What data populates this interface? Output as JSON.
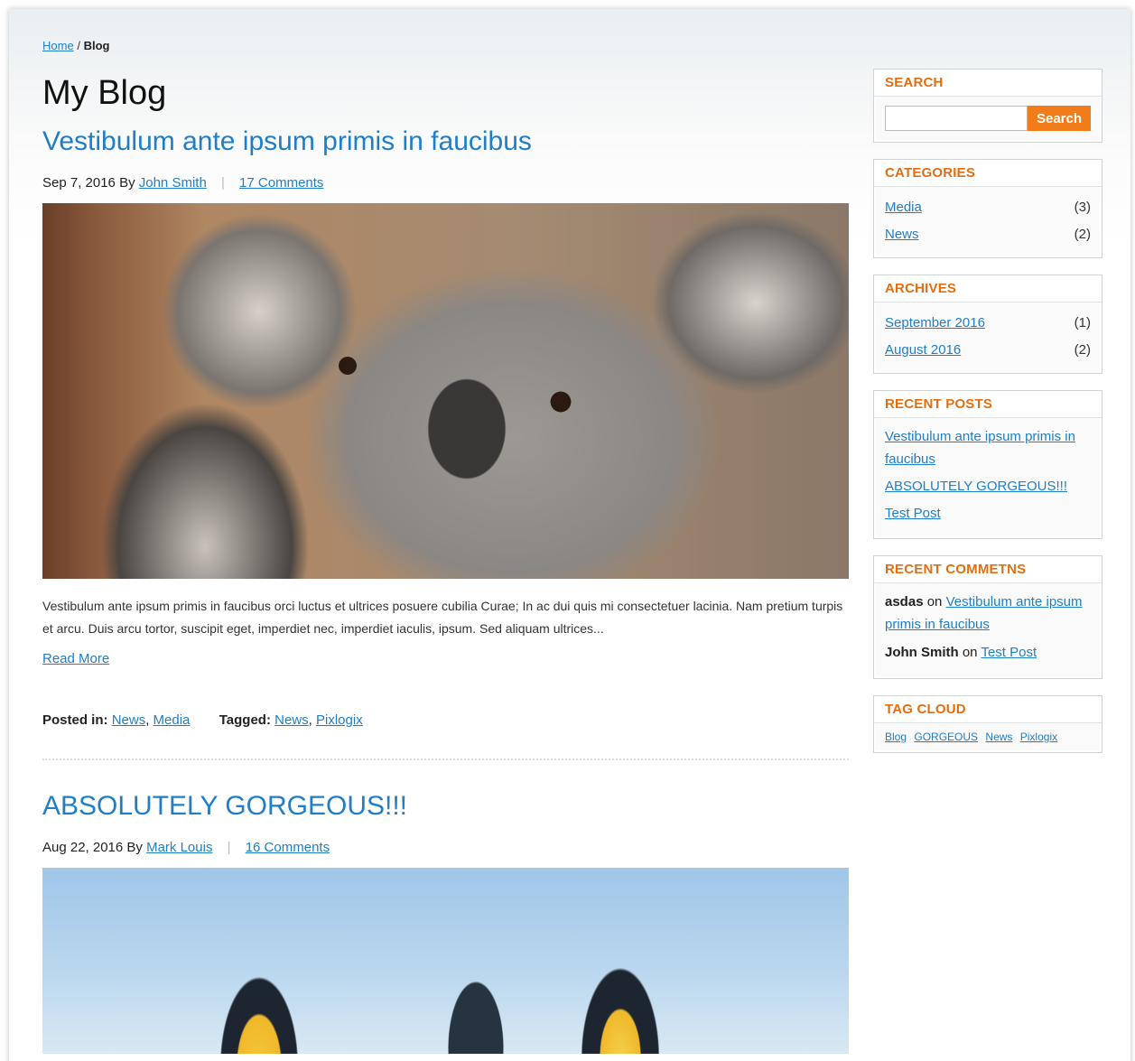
{
  "breadcrumb": {
    "home": "Home",
    "separator": "/",
    "current": "Blog"
  },
  "page_title": "My Blog",
  "posts": [
    {
      "title": "Vestibulum ante ipsum primis in faucibus",
      "date_by": "Sep 7, 2016 By",
      "author": "John Smith",
      "separator": "|",
      "comments": "17 Comments",
      "image": "koala-photo",
      "excerpt": "Vestibulum ante ipsum primis in faucibus orci luctus et ultrices posuere cubilia Curae; In ac dui quis mi consectetuer lacinia. Nam pretium turpis et arcu. Duis arcu tortor, suscipit eget, imperdiet nec, imperdiet iaculis, ipsum. Sed aliquam ultrices...",
      "read_more": "Read More",
      "posted_in_label": "Posted in:",
      "categories": [
        "News",
        "Media"
      ],
      "tagged_label": "Tagged:",
      "tags": [
        "News",
        "Pixlogix"
      ]
    },
    {
      "title": "ABSOLUTELY GORGEOUS!!!",
      "date_by": "Aug 22, 2016 By",
      "author": "Mark Louis",
      "separator": "|",
      "comments": "16 Comments",
      "image": "penguins-photo"
    }
  ],
  "sidebar": {
    "search": {
      "title": "SEARCH",
      "placeholder": "",
      "button": "Search"
    },
    "categories": {
      "title": "CATEGORIES",
      "items": [
        {
          "label": "Media",
          "count": "(3)"
        },
        {
          "label": "News",
          "count": "(2)"
        }
      ]
    },
    "archives": {
      "title": "ARCHIVES",
      "items": [
        {
          "label": "September 2016",
          "count": "(1)"
        },
        {
          "label": "August 2016",
          "count": "(2)"
        }
      ]
    },
    "recent_posts": {
      "title": "RECENT POSTS",
      "items": [
        "Vestibulum ante ipsum primis in faucibus",
        "ABSOLUTELY GORGEOUS!!!",
        "Test Post"
      ]
    },
    "recent_comments": {
      "title": "RECENT COMMETNS",
      "items": [
        {
          "author": "asdas",
          "on": "on",
          "post": "Vestibulum ante ipsum primis in faucibus"
        },
        {
          "author": "John Smith",
          "on": "on",
          "post": "Test Post"
        }
      ]
    },
    "tag_cloud": {
      "title": "TAG CLOUD",
      "tags": [
        "Blog",
        "GORGEOUS",
        "News",
        "Pixlogix"
      ]
    }
  },
  "colors": {
    "link": "#1e7ec8",
    "accent": "#e26e12",
    "button": "#f07c1a"
  }
}
